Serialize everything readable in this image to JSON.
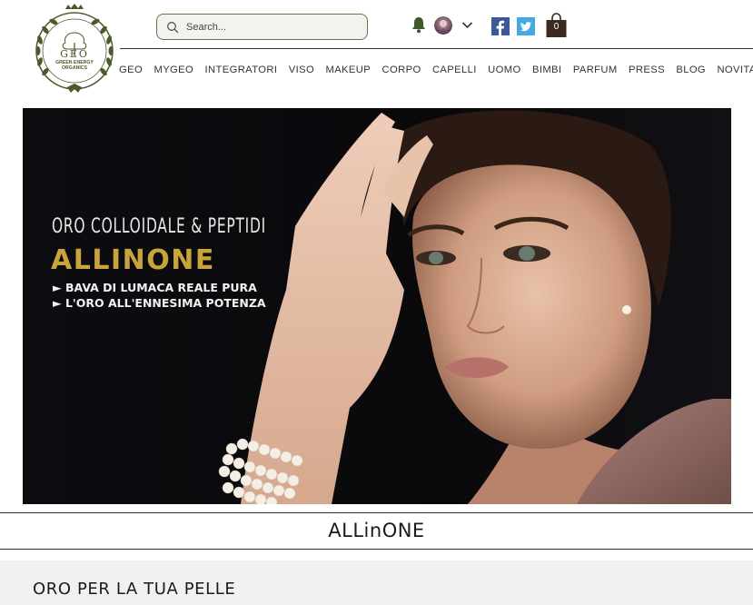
{
  "brand": {
    "name": "GREEN ENERGY ORGANICS",
    "monogram": "GEO",
    "accent_color": "#3e5a2b",
    "logo_color": "#4a5a2a"
  },
  "search": {
    "placeholder": "Search..."
  },
  "header_icons": {
    "notifications": "bell-icon",
    "account": "avatar",
    "account_menu": "chevron-down-icon",
    "facebook": "facebook-icon",
    "twitter": "twitter-icon",
    "cart": "shopping-bag-icon"
  },
  "cart": {
    "count": "0"
  },
  "nav": {
    "items": [
      {
        "label": "GEO"
      },
      {
        "label": "MYGEO"
      },
      {
        "label": "INTEGRATORI"
      },
      {
        "label": "VISO"
      },
      {
        "label": "MAKEUP"
      },
      {
        "label": "CORPO"
      },
      {
        "label": "CAPELLI"
      },
      {
        "label": "UOMO"
      },
      {
        "label": "BIMBI"
      },
      {
        "label": "PARFUM"
      },
      {
        "label": "PRESS"
      },
      {
        "label": "BLOG"
      },
      {
        "label": "NOVITA'"
      }
    ]
  },
  "hero": {
    "kicker": "ORO COLLOIDALE & PEPTIDI",
    "title": "ALLINONE",
    "bullets": [
      "► BAVA DI LUMACA REALE PURA",
      "► L'ORO ALL'ENNESIMA POTENZA"
    ],
    "title_color": "#c9a43a"
  },
  "band": {
    "title": "ALLinONE"
  },
  "section": {
    "heading": "ORO PER LA TUA PELLE"
  }
}
